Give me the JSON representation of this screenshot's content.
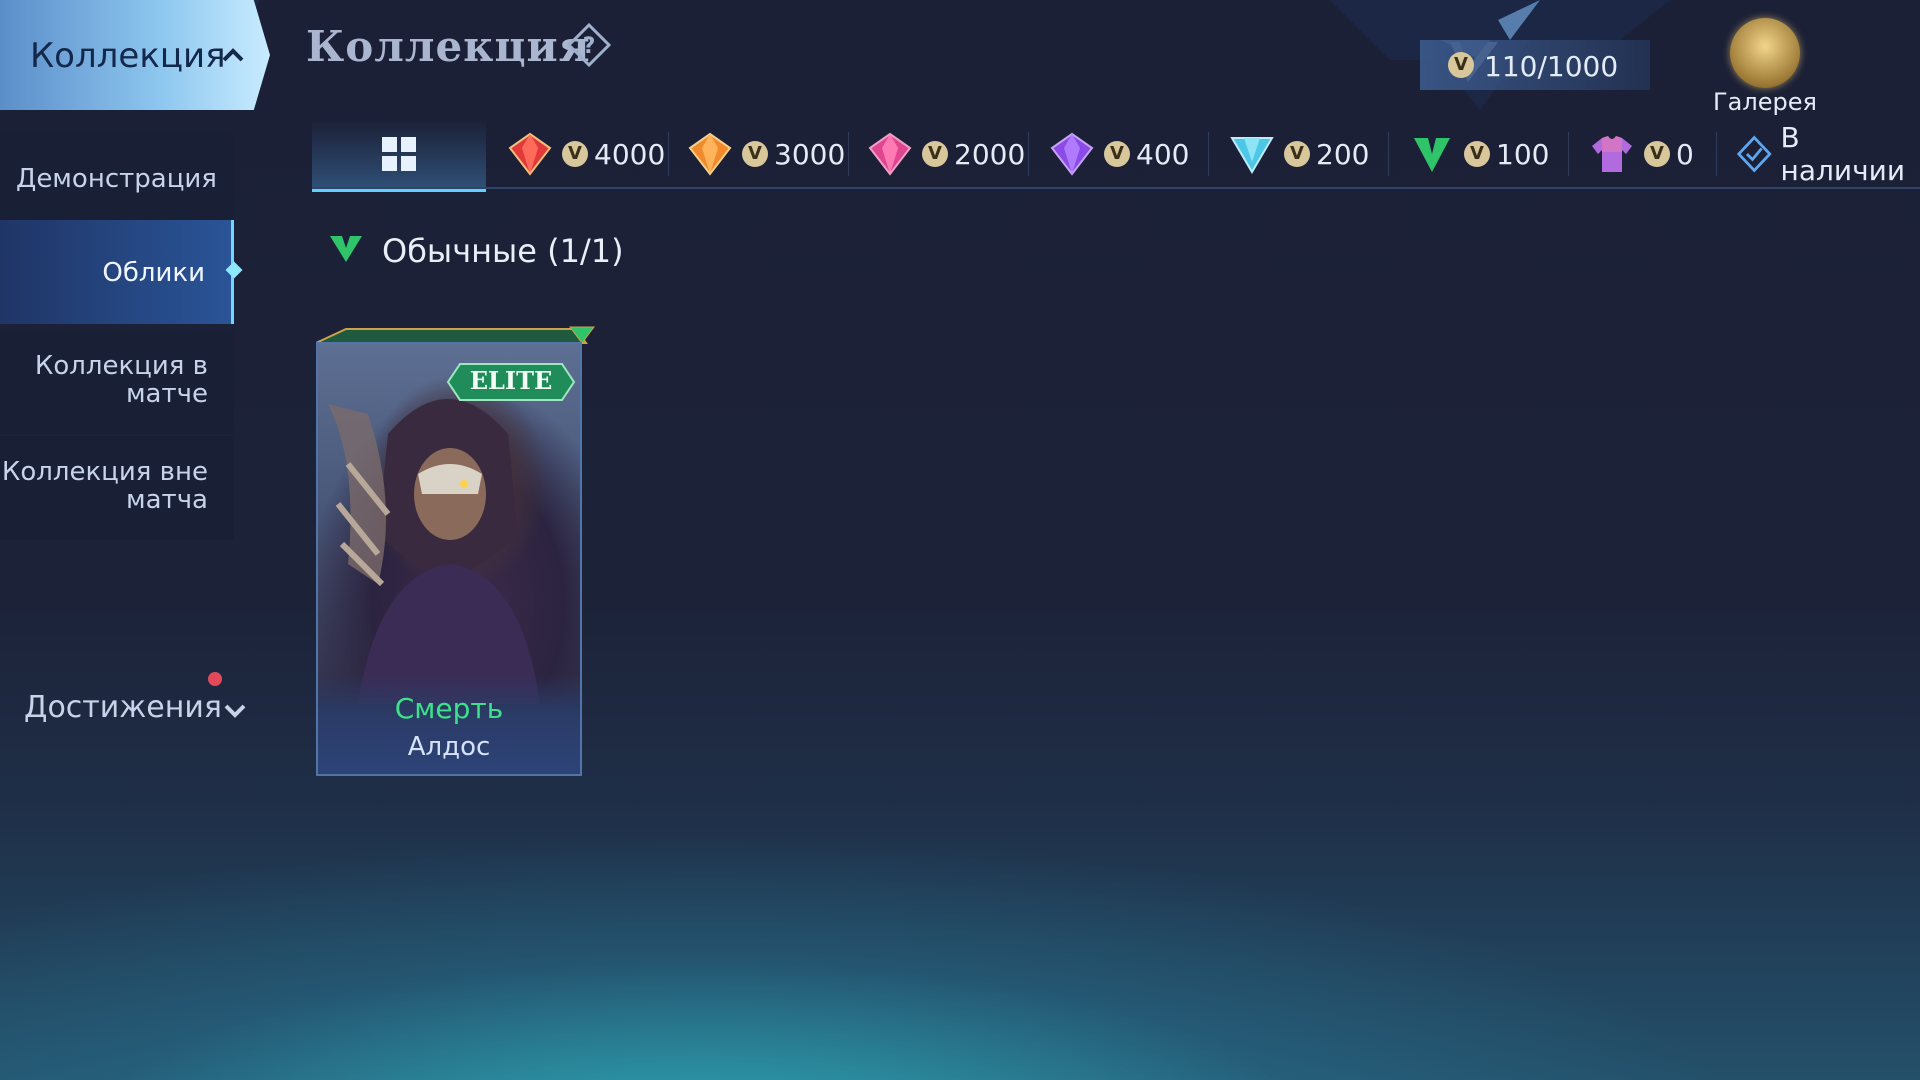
{
  "header": {
    "title": "Коллекция",
    "points": "110/1000",
    "gallery_label": "Галерея"
  },
  "sidebar": {
    "main": "Коллекция",
    "items": [
      "Демонстрация",
      "Облики"
    ],
    "in_match": [
      "Коллекция в",
      "матче"
    ],
    "out_match": [
      "Коллекция вне",
      "матча"
    ],
    "achievements": "Достижения"
  },
  "tabs": [
    {
      "value": "4000",
      "gem": "red-gem-icon",
      "color": "#e23a3a"
    },
    {
      "value": "3000",
      "gem": "orange-gem-icon",
      "color": "#f08a2c"
    },
    {
      "value": "2000",
      "gem": "pink-gem-icon",
      "color": "#e0458f"
    },
    {
      "value": "400",
      "gem": "purple-gem-icon",
      "color": "#8a4be6"
    },
    {
      "value": "200",
      "gem": "cyan-gem-icon",
      "color": "#4cc8e6"
    },
    {
      "value": "100",
      "gem": "green-gem-icon",
      "color": "#2fc46a"
    },
    {
      "value": "0",
      "gem": "shirt-icon",
      "color": "#b26adf"
    }
  ],
  "tab_available": "В наличии",
  "section": {
    "title": "Обычные (1/1)"
  },
  "card": {
    "badge": "ELITE",
    "skin_name": "Смерть",
    "hero_name": "Алдос"
  },
  "coin_glyph": "V",
  "colors": {
    "accent": "#5fd0ff",
    "skin_name": "#3ee08a",
    "badge": "#1f8c5a"
  }
}
